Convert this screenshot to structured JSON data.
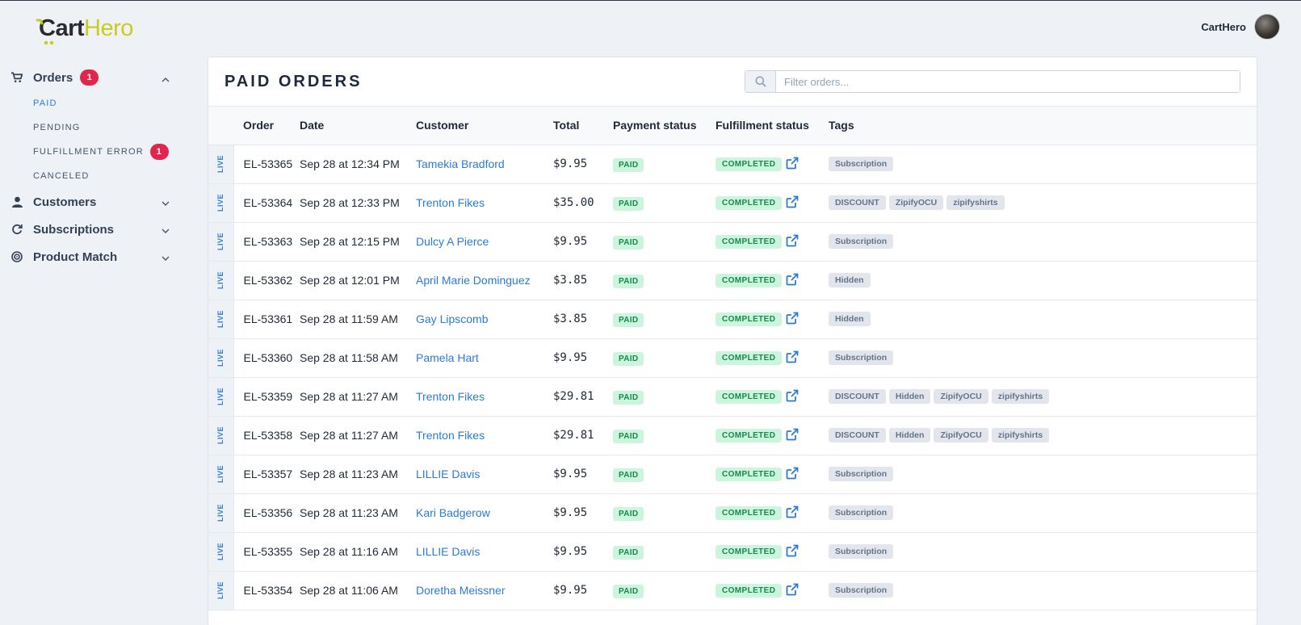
{
  "brand": {
    "cart": "Cart",
    "hero": "Hero"
  },
  "user": {
    "name": "CartHero"
  },
  "sidebar": {
    "orders": {
      "label": "Orders",
      "badge": "1",
      "items": [
        {
          "label": "PAID",
          "active": true
        },
        {
          "label": "PENDING"
        },
        {
          "label": "FULFILLMENT ERROR",
          "badge": "1"
        },
        {
          "label": "CANCELED"
        }
      ]
    },
    "customers": {
      "label": "Customers"
    },
    "subscriptions": {
      "label": "Subscriptions"
    },
    "product_match": {
      "label": "Product Match"
    }
  },
  "main": {
    "title": "PAID ORDERS",
    "filter_placeholder": "Filter orders...",
    "columns": [
      "Order",
      "Date",
      "Customer",
      "Total",
      "Payment status",
      "Fulfillment status",
      "Tags"
    ],
    "rows": [
      {
        "env": "LIVE",
        "order": "EL-53365",
        "date": "Sep 28 at 12:34 PM",
        "customer": "Tamekia Bradford",
        "total": "$9.95",
        "payment": "PAID",
        "fulfillment": "COMPLETED",
        "tags": [
          "Subscription"
        ]
      },
      {
        "env": "LIVE",
        "order": "EL-53364",
        "date": "Sep 28 at 12:33 PM",
        "customer": "Trenton Fikes",
        "total": "$35.00",
        "payment": "PAID",
        "fulfillment": "COMPLETED",
        "tags": [
          "DISCOUNT",
          "ZipifyOCU",
          "zipifyshirts"
        ]
      },
      {
        "env": "LIVE",
        "order": "EL-53363",
        "date": "Sep 28 at 12:15 PM",
        "customer": "Dulcy A Pierce",
        "total": "$9.95",
        "payment": "PAID",
        "fulfillment": "COMPLETED",
        "tags": [
          "Subscription"
        ]
      },
      {
        "env": "LIVE",
        "order": "EL-53362",
        "date": "Sep 28 at 12:01 PM",
        "customer": "April Marie Dominguez",
        "total": "$3.85",
        "payment": "PAID",
        "fulfillment": "COMPLETED",
        "tags": [
          "Hidden"
        ]
      },
      {
        "env": "LIVE",
        "order": "EL-53361",
        "date": "Sep 28 at 11:59 AM",
        "customer": "Gay Lipscomb",
        "total": "$3.85",
        "payment": "PAID",
        "fulfillment": "COMPLETED",
        "tags": [
          "Hidden"
        ]
      },
      {
        "env": "LIVE",
        "order": "EL-53360",
        "date": "Sep 28 at 11:58 AM",
        "customer": "Pamela Hart",
        "total": "$9.95",
        "payment": "PAID",
        "fulfillment": "COMPLETED",
        "tags": [
          "Subscription"
        ]
      },
      {
        "env": "LIVE",
        "order": "EL-53359",
        "date": "Sep 28 at 11:27 AM",
        "customer": "Trenton Fikes",
        "total": "$29.81",
        "payment": "PAID",
        "fulfillment": "COMPLETED",
        "tags": [
          "DISCOUNT",
          "Hidden",
          "ZipifyOCU",
          "zipifyshirts"
        ]
      },
      {
        "env": "LIVE",
        "order": "EL-53358",
        "date": "Sep 28 at 11:27 AM",
        "customer": "Trenton Fikes",
        "total": "$29.81",
        "payment": "PAID",
        "fulfillment": "COMPLETED",
        "tags": [
          "DISCOUNT",
          "Hidden",
          "ZipifyOCU",
          "zipifyshirts"
        ]
      },
      {
        "env": "LIVE",
        "order": "EL-53357",
        "date": "Sep 28 at 11:23 AM",
        "customer": "LILLIE Davis",
        "total": "$9.95",
        "payment": "PAID",
        "fulfillment": "COMPLETED",
        "tags": [
          "Subscription"
        ]
      },
      {
        "env": "LIVE",
        "order": "EL-53356",
        "date": "Sep 28 at 11:23 AM",
        "customer": "Kari Badgerow",
        "total": "$9.95",
        "payment": "PAID",
        "fulfillment": "COMPLETED",
        "tags": [
          "Subscription"
        ]
      },
      {
        "env": "LIVE",
        "order": "EL-53355",
        "date": "Sep 28 at 11:16 AM",
        "customer": "LILLIE Davis",
        "total": "$9.95",
        "payment": "PAID",
        "fulfillment": "COMPLETED",
        "tags": [
          "Subscription"
        ]
      },
      {
        "env": "LIVE",
        "order": "EL-53354",
        "date": "Sep 28 at 11:06 AM",
        "customer": "Doretha Meissner",
        "total": "$9.95",
        "payment": "PAID",
        "fulfillment": "COMPLETED",
        "tags": [
          "Subscription"
        ]
      }
    ]
  },
  "colors": {
    "accent": "#2b7bd6",
    "badge": "#e0264d",
    "paid_bg": "#cdf5de",
    "paid_text": "#138a4e",
    "logo_yellow": "#c9cc1f"
  },
  "icons": {
    "orders": "cart-icon",
    "customers": "user-icon",
    "subscriptions": "refresh-icon",
    "product_match": "target-icon",
    "filter": "search-icon",
    "fulfillment_link": "external-link-icon"
  }
}
